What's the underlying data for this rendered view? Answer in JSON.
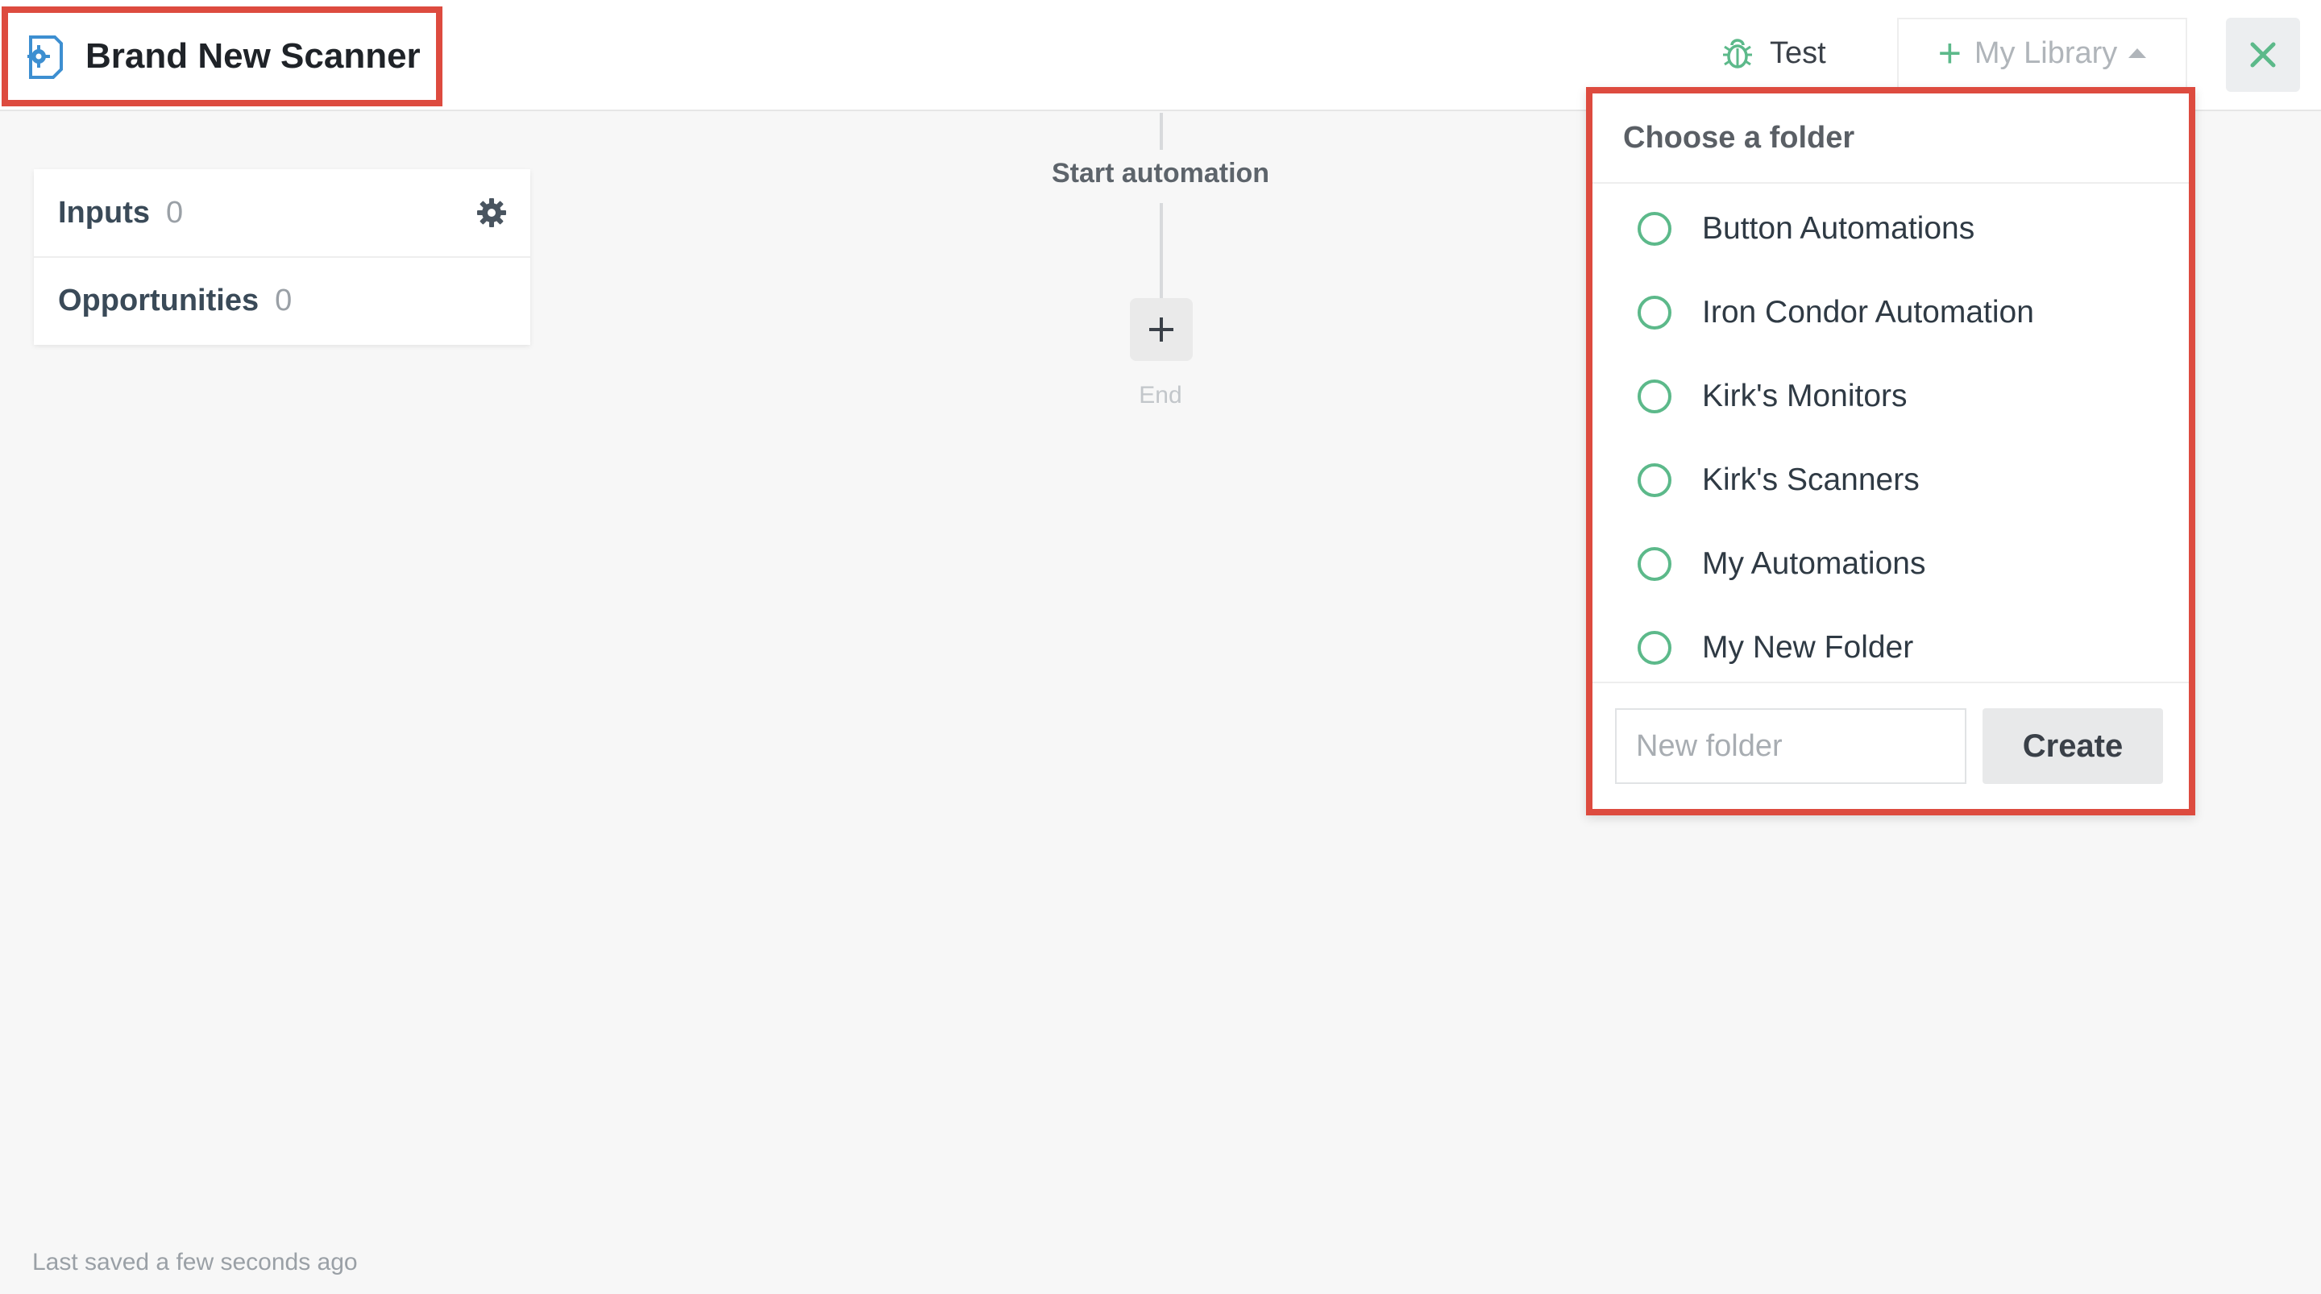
{
  "header": {
    "title": "Brand New Scanner",
    "test_label": "Test",
    "library_label": "My Library"
  },
  "left_panel": {
    "rows": [
      {
        "label": "Inputs",
        "count": "0"
      },
      {
        "label": "Opportunities",
        "count": "0"
      }
    ]
  },
  "flow": {
    "start_label": "Start automation",
    "end_label": "End"
  },
  "folder_menu": {
    "title": "Choose a folder",
    "folders": [
      {
        "label": "Button Automations"
      },
      {
        "label": "Iron Condor Automation"
      },
      {
        "label": "Kirk's Monitors"
      },
      {
        "label": "Kirk's Scanners"
      },
      {
        "label": "My Automations"
      },
      {
        "label": "My New Folder"
      }
    ],
    "new_folder_placeholder": "New folder",
    "create_label": "Create"
  },
  "status": {
    "last_saved": "Last saved a few seconds ago"
  },
  "colors": {
    "accent_green": "#5cb98a",
    "highlight_red": "#dd4b3f",
    "scanner_icon_blue": "#3d8fd1"
  },
  "icons": {
    "title": "scanner-gear-icon",
    "test": "bug-icon",
    "library": "plus-icon",
    "close": "close-icon",
    "settings": "gear-icon"
  }
}
